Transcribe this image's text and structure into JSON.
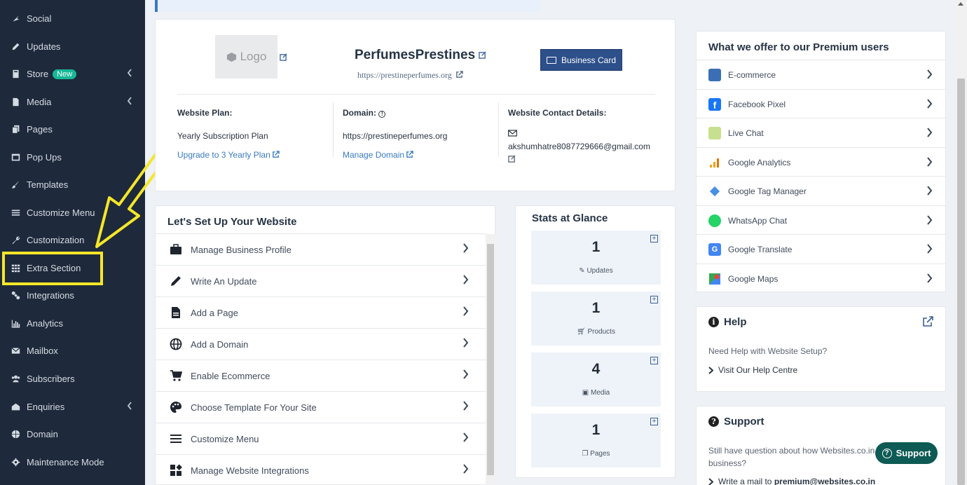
{
  "sidebar": {
    "items": [
      {
        "label": "Social",
        "icon": "social-icon"
      },
      {
        "label": "Updates",
        "icon": "pencil-icon"
      },
      {
        "label": "Store",
        "icon": "store-icon",
        "badge": "New",
        "chevron": true
      },
      {
        "label": "Media",
        "icon": "media-icon",
        "chevron": true
      },
      {
        "label": "Pages",
        "icon": "pages-icon"
      },
      {
        "label": "Pop Ups",
        "icon": "popup-icon"
      },
      {
        "label": "Templates",
        "icon": "brush-icon"
      },
      {
        "label": "Customize Menu",
        "icon": "menu-icon"
      },
      {
        "label": "Customization",
        "icon": "wrench-icon"
      },
      {
        "label": "Extra Section",
        "icon": "grid-icon"
      },
      {
        "label": "Integrations",
        "icon": "link-icon"
      },
      {
        "label": "Analytics",
        "icon": "bar-chart-icon"
      },
      {
        "label": "Mailbox",
        "icon": "mail-icon"
      },
      {
        "label": "Subscribers",
        "icon": "users-icon"
      },
      {
        "label": "Enquiries",
        "icon": "inbox-icon",
        "chevron": true
      },
      {
        "label": "Domain",
        "icon": "globe-icon"
      },
      {
        "label": "Maintenance Mode",
        "icon": "gear-icon"
      }
    ]
  },
  "profile": {
    "logo_label": "Logo",
    "site_name": "PerfumesPrestines",
    "site_url": "https://prestineperfumes.org",
    "business_card_label": "Business Card",
    "plan_label": "Website Plan:",
    "plan_value": "Yearly Subscription Plan",
    "plan_upgrade": "Upgrade to 3 Yearly Plan",
    "domain_label": "Domain:",
    "domain_value": "https://prestineperfumes.org",
    "domain_manage": "Manage Domain",
    "contact_label": "Website Contact Details:",
    "contact_email": "akshumhatre8087729666@gmail.com"
  },
  "setup": {
    "title": "Let's Set Up Your Website",
    "rows": [
      {
        "label": "Manage Business Profile",
        "icon": "briefcase-icon"
      },
      {
        "label": "Write An Update",
        "icon": "pencil-icon"
      },
      {
        "label": "Add a Page",
        "icon": "document-icon"
      },
      {
        "label": "Add a Domain",
        "icon": "globe-icon"
      },
      {
        "label": "Enable Ecommerce",
        "icon": "cart-icon"
      },
      {
        "label": "Choose Template For Your Site",
        "icon": "palette-icon"
      },
      {
        "label": "Customize Menu",
        "icon": "menu-icon"
      },
      {
        "label": "Manage Website Integrations",
        "icon": "widgets-icon"
      }
    ]
  },
  "stats": {
    "title": "Stats at Glance",
    "boxes": [
      {
        "value": "1",
        "label": "Updates"
      },
      {
        "value": "1",
        "label": "Products"
      },
      {
        "value": "4",
        "label": "Media"
      },
      {
        "value": "1",
        "label": "Pages"
      }
    ]
  },
  "premium": {
    "title": "What we offer to our Premium users",
    "rows": [
      {
        "label": "E-commerce",
        "color": "#3b6fb3"
      },
      {
        "label": "Facebook Pixel",
        "color": "#1877f2"
      },
      {
        "label": "Live Chat",
        "color": "#8bc34a"
      },
      {
        "label": "Google Analytics",
        "color": "#f4a015"
      },
      {
        "label": "Google Tag Manager",
        "color": "#4a90e2"
      },
      {
        "label": "WhatsApp Chat",
        "color": "#25d366"
      },
      {
        "label": "Google Translate",
        "color": "#4285f4"
      },
      {
        "label": "Google Maps",
        "color": "#34a853"
      }
    ]
  },
  "help": {
    "title": "Help",
    "question": "Need Help with Website Setup?",
    "link": "Visit Our Help Centre"
  },
  "support": {
    "title": "Support",
    "text_line1": "Still have question about how Websites.co.in",
    "text_line2": "business?",
    "mail_prefix": "Write a mail to",
    "mail_address": "premium@websites.co.in",
    "button_label": "Support"
  },
  "colors": {
    "sidebar_bg": "#1e2a3b",
    "accent": "#2d4f8a",
    "highlight": "#f5e629",
    "badge": "#17b897"
  }
}
